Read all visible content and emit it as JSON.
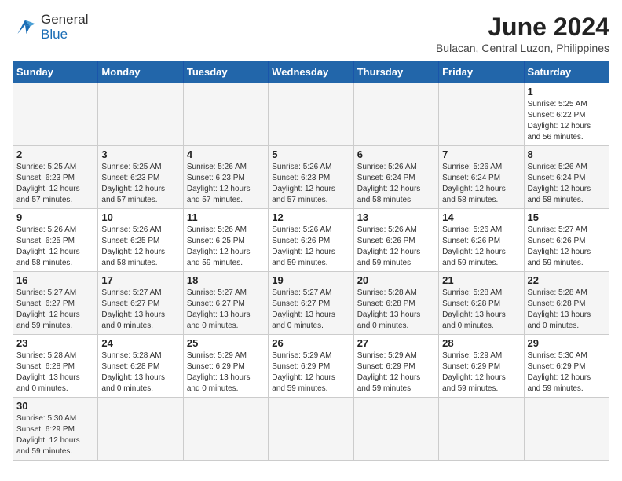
{
  "header": {
    "logo_general": "General",
    "logo_blue": "Blue",
    "month_year": "June 2024",
    "location": "Bulacan, Central Luzon, Philippines"
  },
  "days_of_week": [
    "Sunday",
    "Monday",
    "Tuesday",
    "Wednesday",
    "Thursday",
    "Friday",
    "Saturday"
  ],
  "weeks": [
    [
      {
        "date": "",
        "empty": true
      },
      {
        "date": "",
        "empty": true
      },
      {
        "date": "",
        "empty": true
      },
      {
        "date": "",
        "empty": true
      },
      {
        "date": "",
        "empty": true
      },
      {
        "date": "",
        "empty": true
      },
      {
        "date": "1",
        "sunrise": "5:25 AM",
        "sunset": "6:22 PM",
        "daylight": "12 hours and 56 minutes."
      }
    ],
    [
      {
        "date": "2",
        "sunrise": "5:25 AM",
        "sunset": "6:23 PM",
        "daylight": "12 hours and 57 minutes."
      },
      {
        "date": "3",
        "sunrise": "5:25 AM",
        "sunset": "6:23 PM",
        "daylight": "12 hours and 57 minutes."
      },
      {
        "date": "4",
        "sunrise": "5:26 AM",
        "sunset": "6:23 PM",
        "daylight": "12 hours and 57 minutes."
      },
      {
        "date": "5",
        "sunrise": "5:26 AM",
        "sunset": "6:23 PM",
        "daylight": "12 hours and 57 minutes."
      },
      {
        "date": "6",
        "sunrise": "5:26 AM",
        "sunset": "6:24 PM",
        "daylight": "12 hours and 58 minutes."
      },
      {
        "date": "7",
        "sunrise": "5:26 AM",
        "sunset": "6:24 PM",
        "daylight": "12 hours and 58 minutes."
      },
      {
        "date": "8",
        "sunrise": "5:26 AM",
        "sunset": "6:24 PM",
        "daylight": "12 hours and 58 minutes."
      }
    ],
    [
      {
        "date": "9",
        "sunrise": "5:26 AM",
        "sunset": "6:25 PM",
        "daylight": "12 hours and 58 minutes."
      },
      {
        "date": "10",
        "sunrise": "5:26 AM",
        "sunset": "6:25 PM",
        "daylight": "12 hours and 58 minutes."
      },
      {
        "date": "11",
        "sunrise": "5:26 AM",
        "sunset": "6:25 PM",
        "daylight": "12 hours and 59 minutes."
      },
      {
        "date": "12",
        "sunrise": "5:26 AM",
        "sunset": "6:26 PM",
        "daylight": "12 hours and 59 minutes."
      },
      {
        "date": "13",
        "sunrise": "5:26 AM",
        "sunset": "6:26 PM",
        "daylight": "12 hours and 59 minutes."
      },
      {
        "date": "14",
        "sunrise": "5:26 AM",
        "sunset": "6:26 PM",
        "daylight": "12 hours and 59 minutes."
      },
      {
        "date": "15",
        "sunrise": "5:27 AM",
        "sunset": "6:26 PM",
        "daylight": "12 hours and 59 minutes."
      }
    ],
    [
      {
        "date": "16",
        "sunrise": "5:27 AM",
        "sunset": "6:27 PM",
        "daylight": "12 hours and 59 minutes."
      },
      {
        "date": "17",
        "sunrise": "5:27 AM",
        "sunset": "6:27 PM",
        "daylight": "13 hours and 0 minutes."
      },
      {
        "date": "18",
        "sunrise": "5:27 AM",
        "sunset": "6:27 PM",
        "daylight": "13 hours and 0 minutes."
      },
      {
        "date": "19",
        "sunrise": "5:27 AM",
        "sunset": "6:27 PM",
        "daylight": "13 hours and 0 minutes."
      },
      {
        "date": "20",
        "sunrise": "5:28 AM",
        "sunset": "6:28 PM",
        "daylight": "13 hours and 0 minutes."
      },
      {
        "date": "21",
        "sunrise": "5:28 AM",
        "sunset": "6:28 PM",
        "daylight": "13 hours and 0 minutes."
      },
      {
        "date": "22",
        "sunrise": "5:28 AM",
        "sunset": "6:28 PM",
        "daylight": "13 hours and 0 minutes."
      }
    ],
    [
      {
        "date": "23",
        "sunrise": "5:28 AM",
        "sunset": "6:28 PM",
        "daylight": "13 hours and 0 minutes."
      },
      {
        "date": "24",
        "sunrise": "5:28 AM",
        "sunset": "6:28 PM",
        "daylight": "13 hours and 0 minutes."
      },
      {
        "date": "25",
        "sunrise": "5:29 AM",
        "sunset": "6:29 PM",
        "daylight": "13 hours and 0 minutes."
      },
      {
        "date": "26",
        "sunrise": "5:29 AM",
        "sunset": "6:29 PM",
        "daylight": "12 hours and 59 minutes."
      },
      {
        "date": "27",
        "sunrise": "5:29 AM",
        "sunset": "6:29 PM",
        "daylight": "12 hours and 59 minutes."
      },
      {
        "date": "28",
        "sunrise": "5:29 AM",
        "sunset": "6:29 PM",
        "daylight": "12 hours and 59 minutes."
      },
      {
        "date": "29",
        "sunrise": "5:30 AM",
        "sunset": "6:29 PM",
        "daylight": "12 hours and 59 minutes."
      }
    ],
    [
      {
        "date": "30",
        "sunrise": "5:30 AM",
        "sunset": "6:29 PM",
        "daylight": "12 hours and 59 minutes."
      },
      {
        "date": "",
        "empty": true
      },
      {
        "date": "",
        "empty": true
      },
      {
        "date": "",
        "empty": true
      },
      {
        "date": "",
        "empty": true
      },
      {
        "date": "",
        "empty": true
      },
      {
        "date": "",
        "empty": true
      }
    ]
  ]
}
